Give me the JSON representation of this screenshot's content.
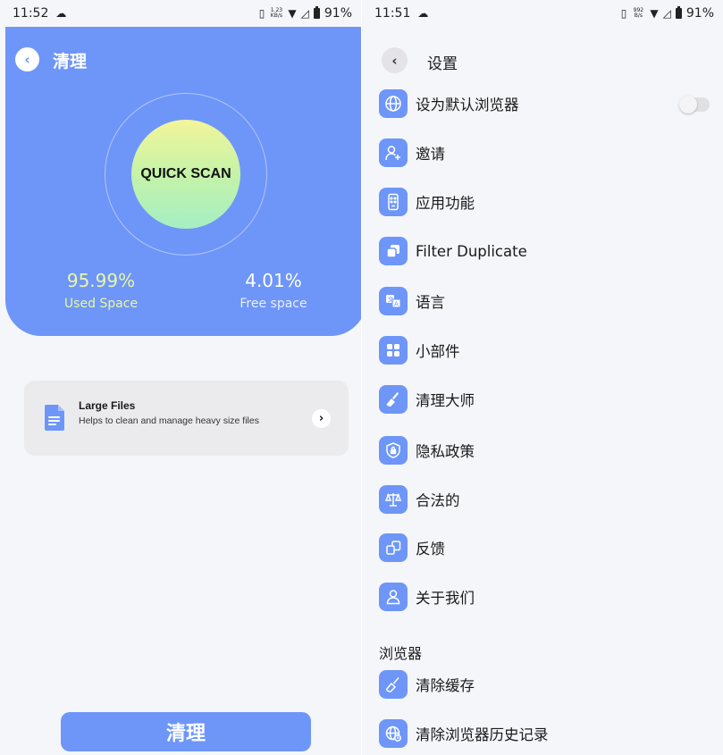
{
  "left": {
    "status": {
      "time": "11:52",
      "net_speed_top": "1.23",
      "net_speed_bottom": "KB/s",
      "battery": "91%"
    },
    "title": "清理",
    "scan_button": "QUICK SCAN",
    "used": {
      "value": "95.99%",
      "label": "Used Space"
    },
    "free": {
      "value": "4.01%",
      "label": "Free space"
    },
    "large_files": {
      "title": "Large Files",
      "description": "Helps to clean and manage heavy size files"
    },
    "clean_button": "清理"
  },
  "right": {
    "status": {
      "time": "11:51",
      "net_speed_top": "992",
      "net_speed_bottom": "B/s",
      "battery": "91%"
    },
    "title": "设置",
    "items": [
      {
        "label": "设为默认浏览器",
        "icon": "globe-icon"
      },
      {
        "label": "邀请",
        "icon": "add-user-icon"
      },
      {
        "label": "应用功能",
        "icon": "remote-icon"
      },
      {
        "label": "Filter Duplicate",
        "icon": "duplicate-icon"
      },
      {
        "label": "语言",
        "icon": "translate-icon"
      },
      {
        "label": "小部件",
        "icon": "widgets-icon"
      },
      {
        "label": "清理大师",
        "icon": "broom-icon"
      },
      {
        "label": "隐私政策",
        "icon": "shield-lock-icon"
      },
      {
        "label": "合法的",
        "icon": "scale-icon"
      },
      {
        "label": "反馈",
        "icon": "feedback-icon"
      },
      {
        "label": "关于我们",
        "icon": "person-icon"
      }
    ],
    "browser_section": {
      "header": "浏览器",
      "items": [
        {
          "label": "清除缓存",
          "icon": "broom-icon"
        },
        {
          "label": "清除浏览器历史记录",
          "icon": "globe-clock-icon"
        }
      ]
    },
    "default_browser_toggle": "off"
  },
  "colors": {
    "accent": "#6e96f8",
    "used_text": "#e9f7a2",
    "card_bg": "#ebebee"
  }
}
